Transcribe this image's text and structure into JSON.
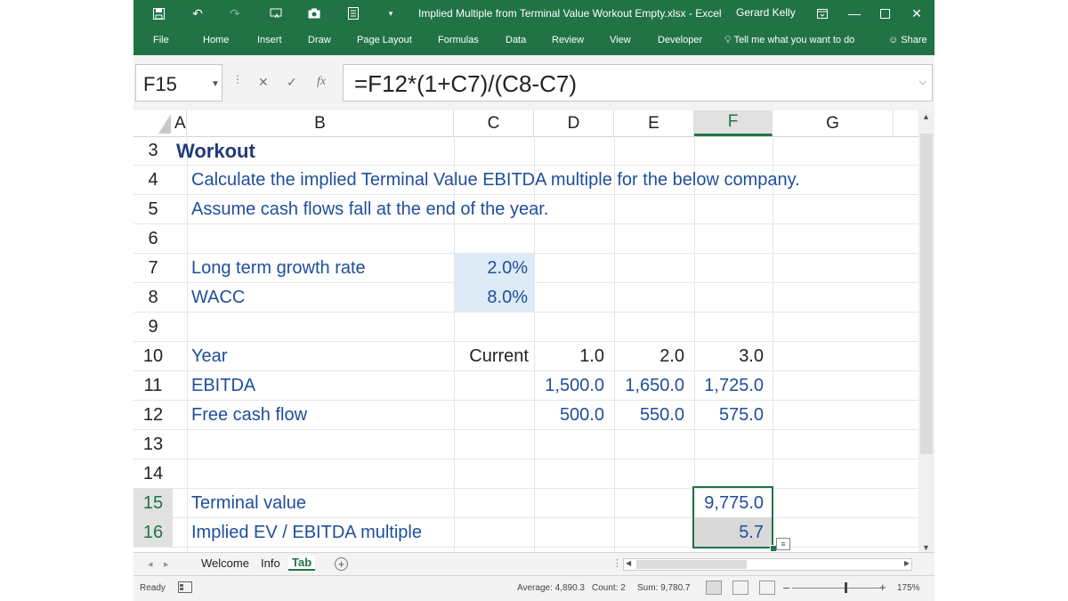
{
  "window": {
    "title": "Implied Multiple from Terminal Value Workout Empty.xlsx  -  Excel",
    "user": "Gerard Kelly"
  },
  "ribbon": {
    "tabs": [
      "File",
      "Home",
      "Insert",
      "Draw",
      "Page Layout",
      "Formulas",
      "Data",
      "Review",
      "View",
      "Developer"
    ],
    "tell_me": "Tell me what you want to do",
    "share": "Share"
  },
  "formula_bar": {
    "name_box": "F15",
    "formula": "=F12*(1+C7)/(C8-C7)",
    "fx": "fx"
  },
  "columns": [
    "A",
    "B",
    "C",
    "D",
    "E",
    "F",
    "G"
  ],
  "selected_column": "F",
  "rows": [
    "3",
    "4",
    "5",
    "6",
    "7",
    "8",
    "9",
    "10",
    "11",
    "12",
    "13",
    "14",
    "15",
    "16"
  ],
  "selected_rows": [
    "15",
    "16"
  ],
  "cells": {
    "a3": "Workout",
    "b4": "Calculate the implied Terminal Value EBITDA multiple for the below company.",
    "b5": "Assume cash flows fall at the end of the year.",
    "b7": "Long term growth rate",
    "c7": "2.0%",
    "b8": "WACC",
    "c8": "8.0%",
    "b10": "Year",
    "c10": "Current",
    "d10": "1.0",
    "e10": "2.0",
    "f10": "3.0",
    "b11": "EBITDA",
    "d11": "1,500.0",
    "e11": "1,650.0",
    "f11": "1,725.0",
    "b12": "Free cash flow",
    "d12": "500.0",
    "e12": "550.0",
    "f12": "575.0",
    "b15": "Terminal value",
    "f15": "9,775.0",
    "b16": "Implied EV / EBITDA multiple",
    "f16": "5.7"
  },
  "sheets": {
    "tabs": [
      "Welcome",
      "Info",
      "Tab"
    ],
    "active": "Tab"
  },
  "status": {
    "mode": "Ready",
    "average": "Average: 4,890.3",
    "count": "Count: 2",
    "sum": "Sum: 9,780.7",
    "zoom": "175%"
  },
  "colors": {
    "excel_green": "#217346",
    "cell_text": "#1f4e9c",
    "input_highlight": "#ddebf7"
  }
}
